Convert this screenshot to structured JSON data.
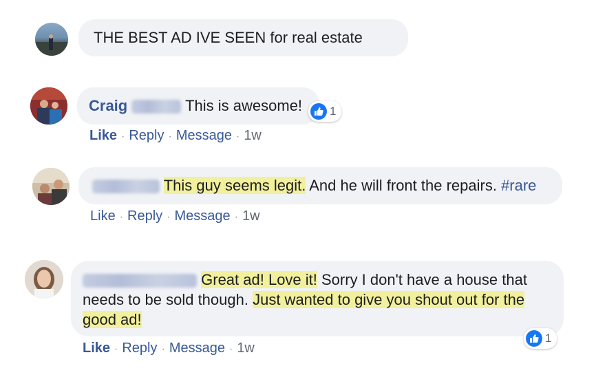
{
  "comments": [
    {
      "text": "THE BEST AD IVE SEEN for real estate"
    },
    {
      "name": "Craig",
      "text": "This is awesome!",
      "reaction_count": "1",
      "actions": {
        "like": "Like",
        "reply": "Reply",
        "message": "Message",
        "time": "1w"
      }
    },
    {
      "text_highlight": "This guy seems legit.",
      "text_rest": " And he will front the repairs. ",
      "hashtag": "#rare",
      "actions": {
        "like": "Like",
        "reply": "Reply",
        "message": "Message",
        "time": "1w"
      }
    },
    {
      "text_highlight_1": "Great ad! Love it!",
      "text_mid": " Sorry I don't have a house that needs to be sold though. ",
      "text_highlight_2": "Just wanted to give you shout out for the good ad! ",
      "reaction_count": "1",
      "actions": {
        "like": "Like",
        "reply": "Reply",
        "message": "Message",
        "time": "1w"
      }
    }
  ],
  "colors": {
    "bubble": "#f0f2f5",
    "name": "#385898",
    "highlight": "#f2f09c",
    "like_icon": "#1877f2"
  },
  "icons": [
    "thumbs-up-icon"
  ]
}
